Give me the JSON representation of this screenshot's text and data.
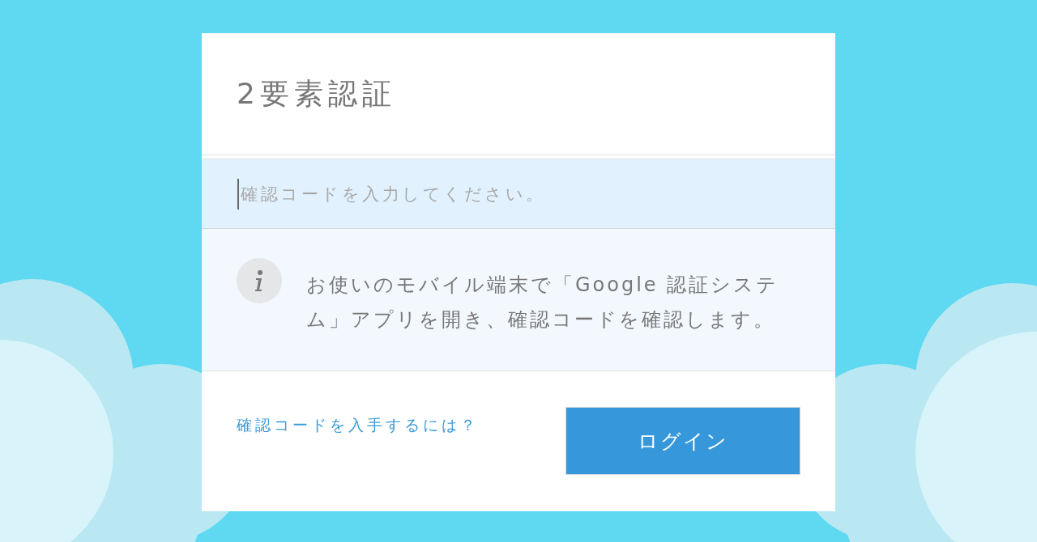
{
  "dialog": {
    "title": "2要素認証",
    "code_field": {
      "placeholder": "確認コードを入力してください。"
    },
    "info": {
      "text": "お使いのモバイル端末で「Google 認証システム」アプリを開き、確認コードを確認します。"
    },
    "help_link": "確認コードを入手するには？",
    "login_button": "ログイン"
  }
}
